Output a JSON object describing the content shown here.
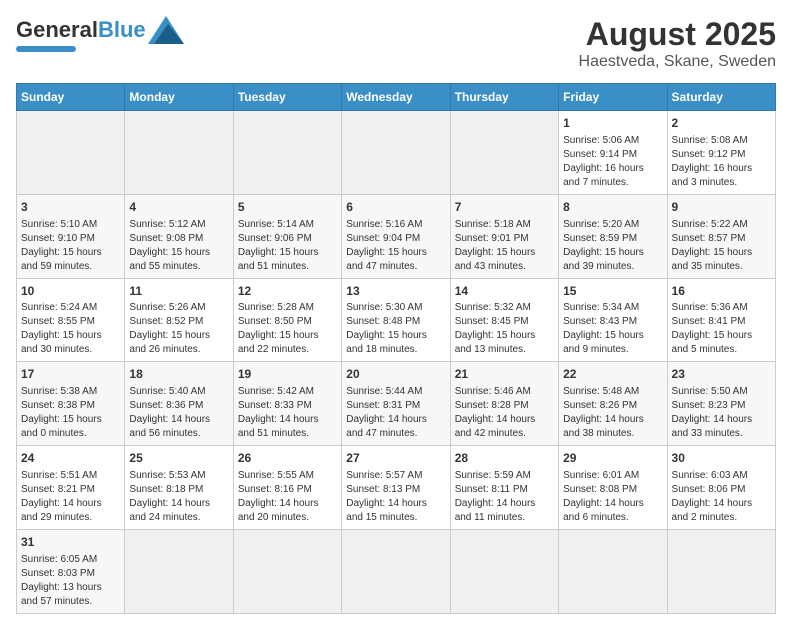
{
  "header": {
    "logo_general": "General",
    "logo_blue": "Blue",
    "title": "August 2025",
    "subtitle": "Haestveda, Skane, Sweden"
  },
  "weekdays": [
    "Sunday",
    "Monday",
    "Tuesday",
    "Wednesday",
    "Thursday",
    "Friday",
    "Saturday"
  ],
  "weeks": [
    [
      {
        "day": "",
        "content": ""
      },
      {
        "day": "",
        "content": ""
      },
      {
        "day": "",
        "content": ""
      },
      {
        "day": "",
        "content": ""
      },
      {
        "day": "",
        "content": ""
      },
      {
        "day": "1",
        "content": "Sunrise: 5:06 AM\nSunset: 9:14 PM\nDaylight: 16 hours and 7 minutes."
      },
      {
        "day": "2",
        "content": "Sunrise: 5:08 AM\nSunset: 9:12 PM\nDaylight: 16 hours and 3 minutes."
      }
    ],
    [
      {
        "day": "3",
        "content": "Sunrise: 5:10 AM\nSunset: 9:10 PM\nDaylight: 15 hours and 59 minutes."
      },
      {
        "day": "4",
        "content": "Sunrise: 5:12 AM\nSunset: 9:08 PM\nDaylight: 15 hours and 55 minutes."
      },
      {
        "day": "5",
        "content": "Sunrise: 5:14 AM\nSunset: 9:06 PM\nDaylight: 15 hours and 51 minutes."
      },
      {
        "day": "6",
        "content": "Sunrise: 5:16 AM\nSunset: 9:04 PM\nDaylight: 15 hours and 47 minutes."
      },
      {
        "day": "7",
        "content": "Sunrise: 5:18 AM\nSunset: 9:01 PM\nDaylight: 15 hours and 43 minutes."
      },
      {
        "day": "8",
        "content": "Sunrise: 5:20 AM\nSunset: 8:59 PM\nDaylight: 15 hours and 39 minutes."
      },
      {
        "day": "9",
        "content": "Sunrise: 5:22 AM\nSunset: 8:57 PM\nDaylight: 15 hours and 35 minutes."
      }
    ],
    [
      {
        "day": "10",
        "content": "Sunrise: 5:24 AM\nSunset: 8:55 PM\nDaylight: 15 hours and 30 minutes."
      },
      {
        "day": "11",
        "content": "Sunrise: 5:26 AM\nSunset: 8:52 PM\nDaylight: 15 hours and 26 minutes."
      },
      {
        "day": "12",
        "content": "Sunrise: 5:28 AM\nSunset: 8:50 PM\nDaylight: 15 hours and 22 minutes."
      },
      {
        "day": "13",
        "content": "Sunrise: 5:30 AM\nSunset: 8:48 PM\nDaylight: 15 hours and 18 minutes."
      },
      {
        "day": "14",
        "content": "Sunrise: 5:32 AM\nSunset: 8:45 PM\nDaylight: 15 hours and 13 minutes."
      },
      {
        "day": "15",
        "content": "Sunrise: 5:34 AM\nSunset: 8:43 PM\nDaylight: 15 hours and 9 minutes."
      },
      {
        "day": "16",
        "content": "Sunrise: 5:36 AM\nSunset: 8:41 PM\nDaylight: 15 hours and 5 minutes."
      }
    ],
    [
      {
        "day": "17",
        "content": "Sunrise: 5:38 AM\nSunset: 8:38 PM\nDaylight: 15 hours and 0 minutes."
      },
      {
        "day": "18",
        "content": "Sunrise: 5:40 AM\nSunset: 8:36 PM\nDaylight: 14 hours and 56 minutes."
      },
      {
        "day": "19",
        "content": "Sunrise: 5:42 AM\nSunset: 8:33 PM\nDaylight: 14 hours and 51 minutes."
      },
      {
        "day": "20",
        "content": "Sunrise: 5:44 AM\nSunset: 8:31 PM\nDaylight: 14 hours and 47 minutes."
      },
      {
        "day": "21",
        "content": "Sunrise: 5:46 AM\nSunset: 8:28 PM\nDaylight: 14 hours and 42 minutes."
      },
      {
        "day": "22",
        "content": "Sunrise: 5:48 AM\nSunset: 8:26 PM\nDaylight: 14 hours and 38 minutes."
      },
      {
        "day": "23",
        "content": "Sunrise: 5:50 AM\nSunset: 8:23 PM\nDaylight: 14 hours and 33 minutes."
      }
    ],
    [
      {
        "day": "24",
        "content": "Sunrise: 5:51 AM\nSunset: 8:21 PM\nDaylight: 14 hours and 29 minutes."
      },
      {
        "day": "25",
        "content": "Sunrise: 5:53 AM\nSunset: 8:18 PM\nDaylight: 14 hours and 24 minutes."
      },
      {
        "day": "26",
        "content": "Sunrise: 5:55 AM\nSunset: 8:16 PM\nDaylight: 14 hours and 20 minutes."
      },
      {
        "day": "27",
        "content": "Sunrise: 5:57 AM\nSunset: 8:13 PM\nDaylight: 14 hours and 15 minutes."
      },
      {
        "day": "28",
        "content": "Sunrise: 5:59 AM\nSunset: 8:11 PM\nDaylight: 14 hours and 11 minutes."
      },
      {
        "day": "29",
        "content": "Sunrise: 6:01 AM\nSunset: 8:08 PM\nDaylight: 14 hours and 6 minutes."
      },
      {
        "day": "30",
        "content": "Sunrise: 6:03 AM\nSunset: 8:06 PM\nDaylight: 14 hours and 2 minutes."
      }
    ],
    [
      {
        "day": "31",
        "content": "Sunrise: 6:05 AM\nSunset: 8:03 PM\nDaylight: 13 hours and 57 minutes."
      },
      {
        "day": "",
        "content": ""
      },
      {
        "day": "",
        "content": ""
      },
      {
        "day": "",
        "content": ""
      },
      {
        "day": "",
        "content": ""
      },
      {
        "day": "",
        "content": ""
      },
      {
        "day": "",
        "content": ""
      }
    ]
  ]
}
